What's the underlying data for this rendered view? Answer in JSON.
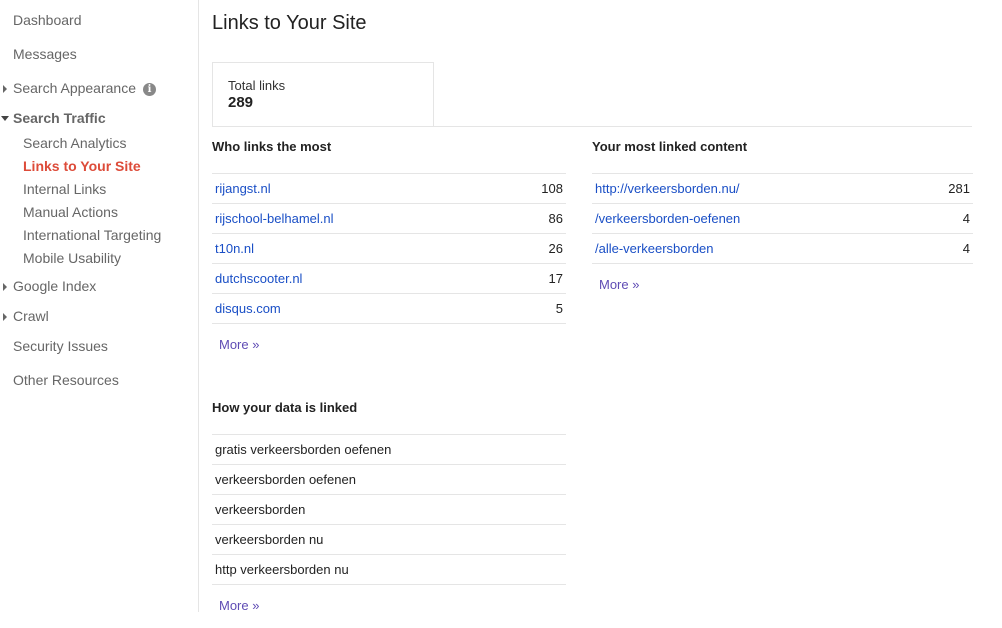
{
  "sidebar": {
    "dashboard": "Dashboard",
    "messages": "Messages",
    "search_appearance": "Search Appearance",
    "search_traffic": "Search Traffic",
    "sub": [
      "Search Analytics",
      "Links to Your Site",
      "Internal Links",
      "Manual Actions",
      "International Targeting",
      "Mobile Usability"
    ],
    "google_index": "Google Index",
    "crawl": "Crawl",
    "security_issues": "Security Issues",
    "other_resources": "Other Resources"
  },
  "page": {
    "title": "Links to Your Site",
    "total_label": "Total links",
    "total_value": "289"
  },
  "who_links": {
    "title": "Who links the most",
    "rows": [
      {
        "site": "rijangst.nl",
        "count": "108"
      },
      {
        "site": "rijschool-belhamel.nl",
        "count": "86"
      },
      {
        "site": "t10n.nl",
        "count": "26"
      },
      {
        "site": "dutchscooter.nl",
        "count": "17"
      },
      {
        "site": "disqus.com",
        "count": "5"
      }
    ],
    "more": "More »"
  },
  "most_linked": {
    "title": "Your most linked content",
    "rows": [
      {
        "page": "http://verkeersborden.nu/",
        "count": "281"
      },
      {
        "page": "/verkeersborden-oefenen",
        "count": "4"
      },
      {
        "page": "/alle-verkeersborden",
        "count": "4"
      }
    ],
    "more": "More »"
  },
  "data_linked": {
    "title": "How your data is linked",
    "rows": [
      "gratis verkeersborden oefenen",
      "verkeersborden oefenen",
      "verkeersborden",
      "verkeersborden nu",
      "http verkeersborden nu"
    ],
    "more": "More »"
  },
  "colors": {
    "link": "#1a4fc6",
    "active": "#dd4b39",
    "more": "#5f4cb4"
  }
}
